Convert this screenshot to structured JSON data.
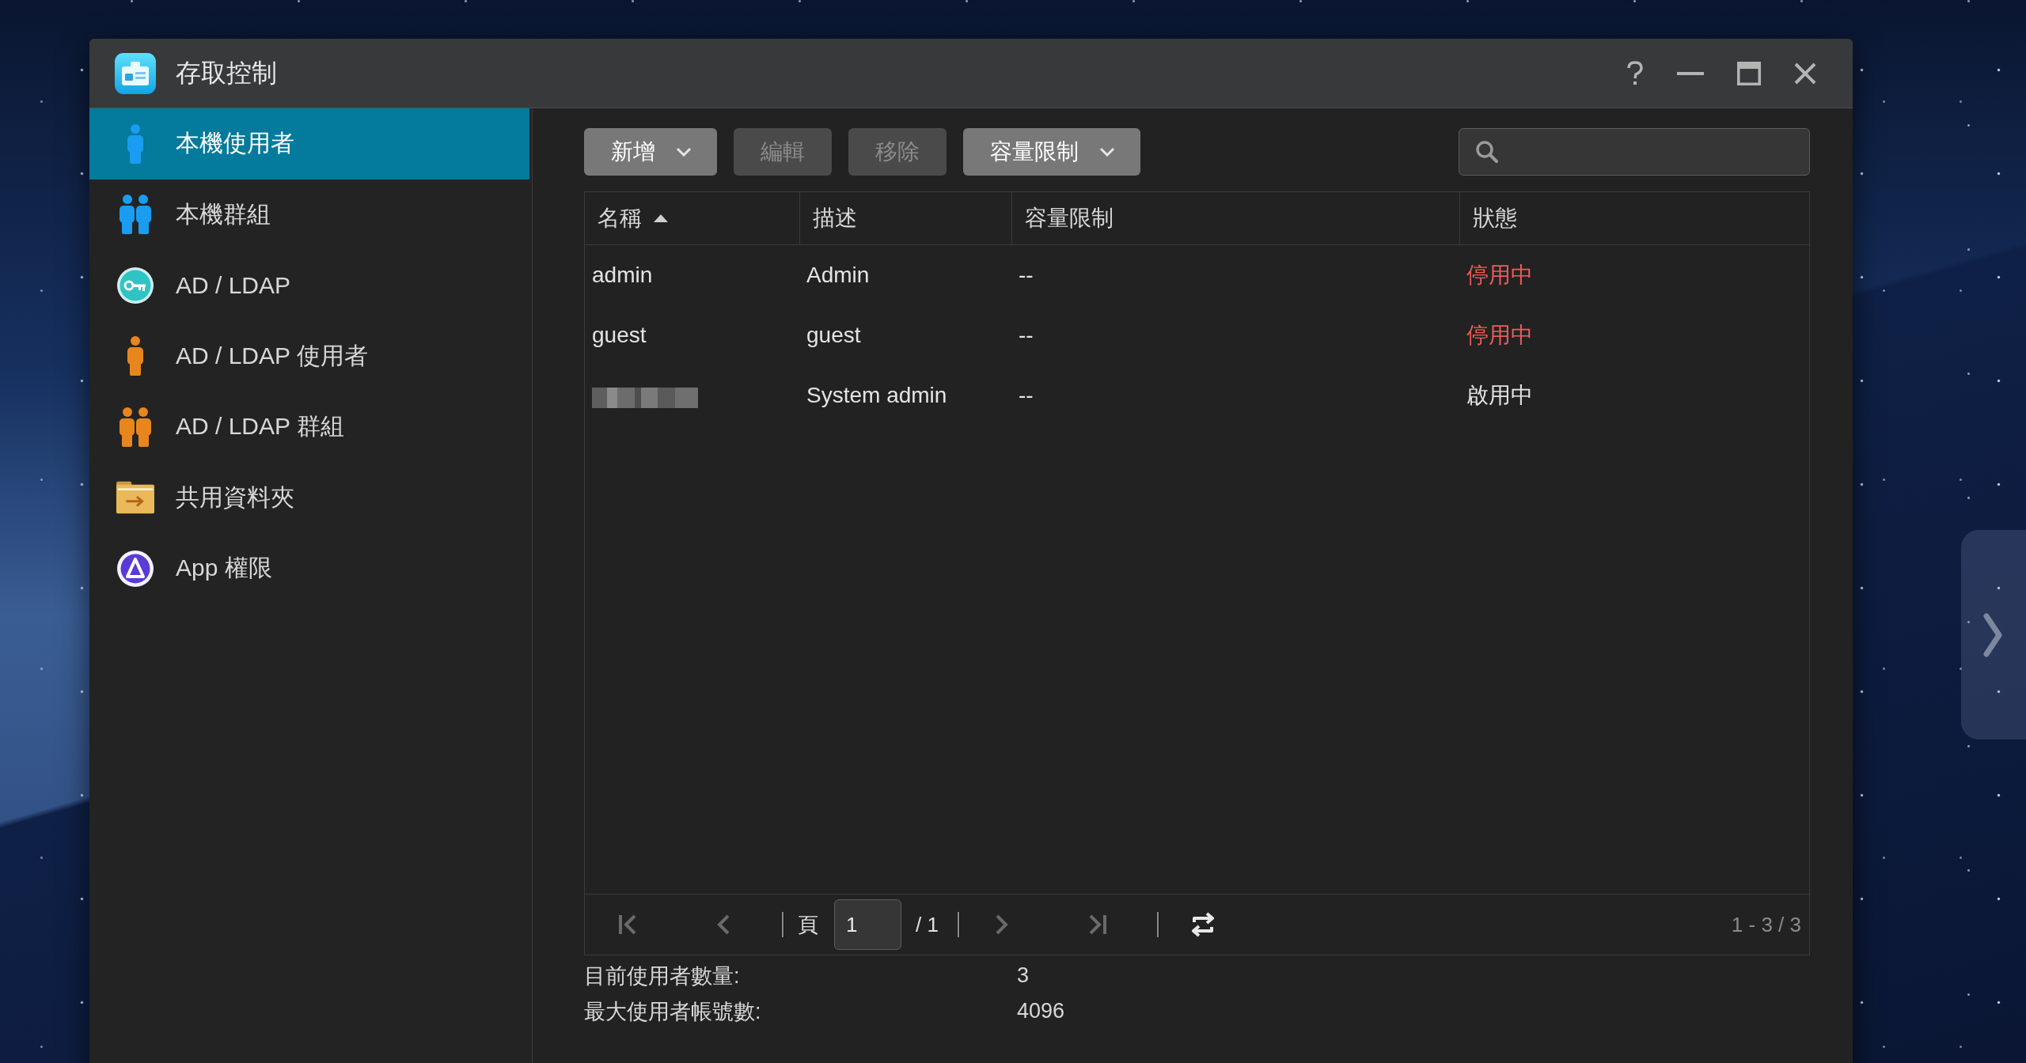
{
  "window": {
    "title": "存取控制"
  },
  "sidebar": {
    "items": [
      {
        "label": "本機使用者",
        "kind": "user",
        "color": "#1a9cf0",
        "selected": true
      },
      {
        "label": "本機群組",
        "kind": "group",
        "color": "#1a9cf0",
        "selected": false
      },
      {
        "label": "AD / LDAP",
        "kind": "directory",
        "color": "#2fc4c4",
        "selected": false
      },
      {
        "label": "AD / LDAP 使用者",
        "kind": "user",
        "color": "#e8861e",
        "selected": false
      },
      {
        "label": "AD / LDAP 群組",
        "kind": "group",
        "color": "#e8861e",
        "selected": false
      },
      {
        "label": "共用資料夾",
        "kind": "folder",
        "color": "#e9b95a",
        "selected": false
      },
      {
        "label": "App 權限",
        "kind": "app",
        "color": "#5a3bd6",
        "selected": false
      }
    ]
  },
  "toolbar": {
    "buttons": [
      {
        "label": "新增",
        "kind": "dropdown",
        "disabled": false
      },
      {
        "label": "編輯",
        "kind": "plain",
        "disabled": true
      },
      {
        "label": "移除",
        "kind": "plain",
        "disabled": true
      },
      {
        "label": "容量限制",
        "kind": "dropdown",
        "disabled": false
      }
    ]
  },
  "table": {
    "columns": [
      {
        "label": "名稱",
        "sorted": true
      },
      {
        "label": "描述",
        "sorted": false
      },
      {
        "label": "容量限制",
        "sorted": false
      },
      {
        "label": "狀態",
        "sorted": false
      }
    ],
    "rows": [
      {
        "name": "admin",
        "redacted": false,
        "description": "Admin",
        "quota": "--",
        "status": "停用中",
        "enabled": false
      },
      {
        "name": "guest",
        "redacted": false,
        "description": "guest",
        "quota": "--",
        "status": "停用中",
        "enabled": false
      },
      {
        "redacted": true,
        "description": "System admin",
        "quota": "--",
        "status": "啟用中",
        "enabled": true
      }
    ]
  },
  "pager": {
    "buttons": [
      {
        "kind": "first",
        "disabled": true
      },
      {
        "kind": "previous",
        "disabled": true
      },
      {
        "kind": "next",
        "disabled": true
      },
      {
        "kind": "last",
        "disabled": true
      },
      {
        "kind": "refresh",
        "disabled": false
      }
    ],
    "page_label": "頁",
    "page_value": "1",
    "page_total": "/ 1",
    "range": "1 - 3 / 3"
  },
  "summary": [
    {
      "label": "目前使用者數量:",
      "value": "3"
    },
    {
      "label": "最大使用者帳號數:",
      "value": "4096"
    }
  ]
}
